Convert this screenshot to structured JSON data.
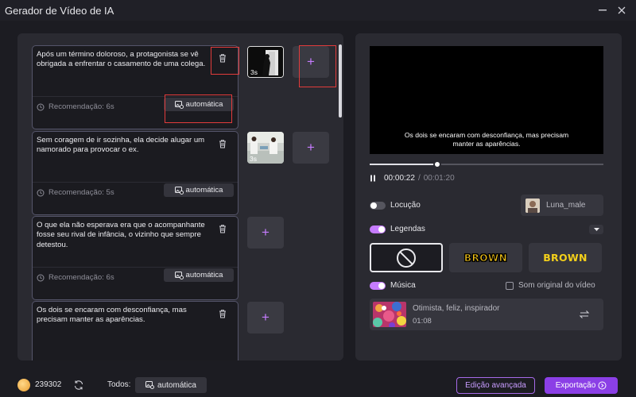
{
  "window": {
    "title": "Gerador de Vídeo de IA",
    "minimize_icon": "minimize-icon",
    "close_icon": "close-icon"
  },
  "scenes": [
    {
      "text": "Após um término doloroso, a protagonista se vê obrigada a enfrentar o casamento de uma colega.",
      "recommendation": "Recomendação: 6s",
      "auto_label": "automática",
      "thumb_duration": "3s",
      "has_thumb": true
    },
    {
      "text": "Sem coragem de ir sozinha, ela decide alugar um namorado para provocar o ex.",
      "recommendation": "Recomendação: 5s",
      "auto_label": "automática",
      "thumb_duration": "3s",
      "has_thumb": true
    },
    {
      "text": "O que ela não esperava era que o acompanhante fosse seu rival de infância, o vizinho que sempre detestou.",
      "recommendation": "Recomendação: 6s",
      "auto_label": "automática",
      "has_thumb": false
    },
    {
      "text": "Os dois se encaram com desconfiança, mas precisam manter as aparências.",
      "has_thumb": false
    }
  ],
  "add_icon": "+",
  "preview": {
    "subtitle": "Os dois se encaram com desconfiança, mas precisam manter as aparências.",
    "current_time": "00:00:22",
    "separator": "/",
    "total_time": "00:01:20",
    "progress": 0.29
  },
  "narration": {
    "label": "Locução",
    "enabled": false,
    "voice_name": "Luna_male"
  },
  "captions": {
    "label": "Legendas",
    "enabled": true,
    "styles": [
      {
        "name": "none",
        "text": ""
      },
      {
        "name": "brown-outline",
        "text": "BROWN"
      },
      {
        "name": "brown-plain",
        "text": "BROWN"
      }
    ],
    "selected_style": 0
  },
  "music": {
    "label": "Música",
    "enabled": true,
    "original_sound_label": "Som original do vídeo",
    "original_sound_checked": false,
    "track_name": "Otimista, feliz, inspirador",
    "track_duration": "01:08"
  },
  "bottom": {
    "credits": "239302",
    "all_label": "Todos:",
    "all_auto_label": "automática",
    "advanced_label": "Edição avançada",
    "export_label": "Exportação"
  },
  "colors": {
    "accent": "#8b3fe6",
    "toggle_on": "#c67cff",
    "highlight": "#e23b3b"
  }
}
